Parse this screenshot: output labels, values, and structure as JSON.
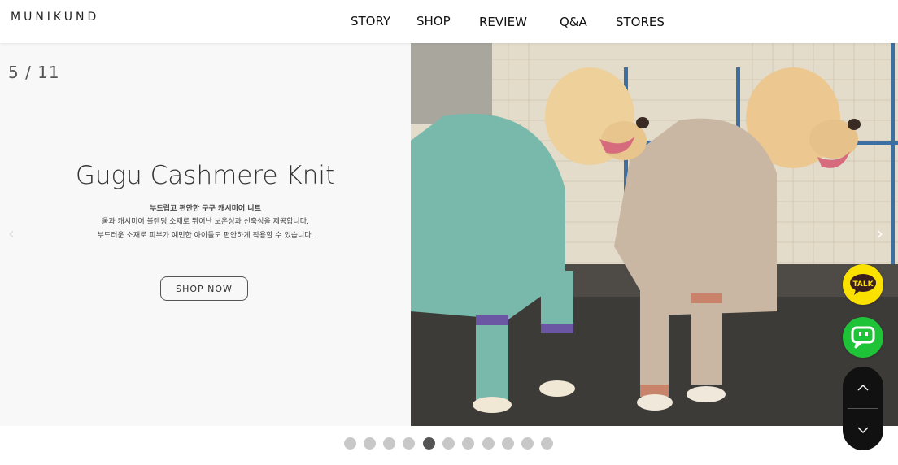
{
  "header": {
    "logo": "MUNIKUND",
    "nav": [
      "STORY",
      "SHOP",
      "REVIEW",
      "Q&A",
      "STORES"
    ]
  },
  "slide": {
    "counter": "5 / 11",
    "title": "Gugu Cashmere Knit",
    "desc_line1": "부드럽고 편안한 구구 캐시미어 니트",
    "desc_line2": "울과 캐시미어 블렌딩 소재로 뛰어난 보온성과 신축성을 제공합니다.",
    "desc_line3": "부드러운 소재로 피부가 예민한 아이들도 편안하게 착용할 수 있습니다.",
    "button": "SHOP NOW",
    "prev": "‹",
    "next": "›"
  },
  "pagination": {
    "total": 11,
    "current": 5
  },
  "floating": {
    "talk": "TALK"
  },
  "colors": {
    "talk": "#fae100",
    "chat": "#1fc338",
    "sweater_mint": "#78b9ab",
    "sweater_beige": "#c9b7a4"
  }
}
